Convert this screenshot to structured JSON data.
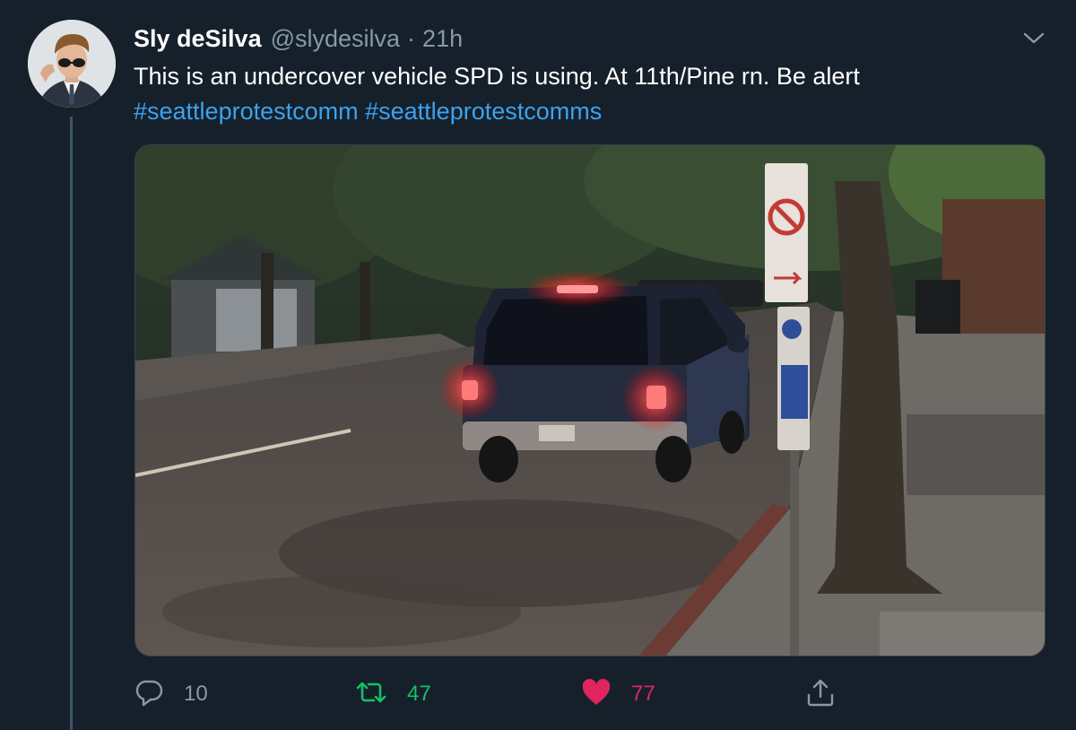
{
  "tweet": {
    "author_name": "Sly deSilva",
    "handle": "@slydesilva",
    "separator": "·",
    "time": "21h",
    "text": "This is an undercover vehicle SPD is using. At 11th/Pine rn. Be alert",
    "hashtags": [
      "#seattleprotestcomm",
      "#seattleprotestcomms"
    ]
  },
  "actions": {
    "replies": "10",
    "retweets": "47",
    "likes": "77"
  },
  "icons": {
    "caret": "chevron-down-icon",
    "reply": "reply-icon",
    "retweet": "retweet-icon",
    "like": "heart-icon",
    "share": "share-icon"
  },
  "colors": {
    "background": "#15202b",
    "text": "#ffffff",
    "secondary": "#8899a6",
    "link": "#3da2ed",
    "retweet": "#17bf63",
    "like": "#e0245e"
  }
}
